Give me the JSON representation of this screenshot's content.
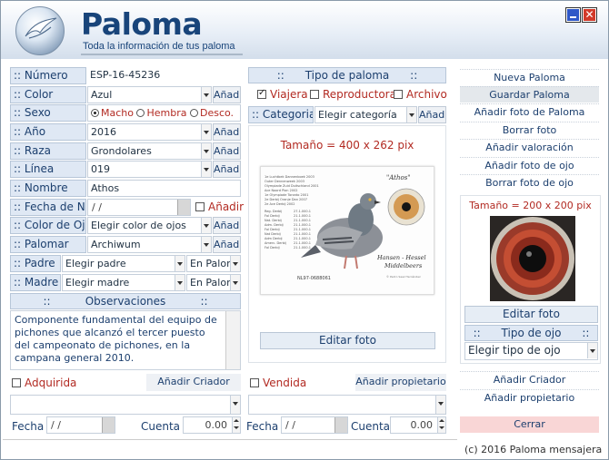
{
  "app": {
    "brand": "Paloma",
    "tagline": "Toda la información de tus paloma",
    "copyright": "(c) 2016 Paloma mensajera"
  },
  "form": {
    "numero": {
      "label": ":: Número",
      "value": "ESP-16-45236"
    },
    "color": {
      "label": ":: Color",
      "value": "Azul",
      "add": "Añad."
    },
    "sexo": {
      "label": ":: Sexo",
      "options": [
        "Macho",
        "Hembra",
        "Desco."
      ],
      "selected": "Macho"
    },
    "anio": {
      "label": ":: Año",
      "value": "2016",
      "add": "Añad."
    },
    "raza": {
      "label": ":: Raza",
      "value": "Grondolares",
      "add": "Añad."
    },
    "linea": {
      "label": ":: Línea",
      "value": "019",
      "add": "Añad."
    },
    "nombre": {
      "label": ":: Nombre",
      "value": "Athos"
    },
    "fecha_na": {
      "label": ":: Fecha de Na.",
      "value": "/ /",
      "check_label": "Añadir"
    },
    "color_ojo": {
      "label": ":: Color de Ojo",
      "placeholder": "Elegir color de ojos",
      "add": "Añad."
    },
    "palomar": {
      "label": ":: Palomar",
      "value": "Archiwum",
      "add": "Añad."
    },
    "padre": {
      "label": ":: Padre",
      "placeholder": "Elegir padre",
      "palomar": "En Palom"
    },
    "madre": {
      "label": ":: Madre",
      "placeholder": "Elegir madre",
      "palomar": "En Palom"
    },
    "observaciones": {
      "title": "::          Observaciones          ::",
      "text": "Componente fundamental del equipo de pichones que alcanzó el tercer puesto del campeonato de pichones, en la campana general 2010."
    },
    "adquirida": {
      "label": "Adquirida",
      "button": "Añadir Criador",
      "fecha_label": "Fecha",
      "fecha": "/ /",
      "cuenta_label": "Cuenta :",
      "cuenta": "0.00"
    },
    "vendida": {
      "label": "Vendida",
      "button": "Añadir propietario",
      "fecha_label": "Fecha :",
      "fecha": "/ /",
      "cuenta_label": "Cuenta :",
      "cuenta": "0.00"
    }
  },
  "tipo": {
    "title": "::      Tipo de paloma      ::",
    "options": [
      {
        "label": "Viajera",
        "checked": true
      },
      {
        "label": "Reproductora",
        "checked": false
      },
      {
        "label": "Archivo",
        "checked": false
      }
    ],
    "categorias_label": ":: Categorias",
    "categorias_placeholder": "Elegir categoría",
    "add": "Añad."
  },
  "photo": {
    "size_label": "Tamaño = 400 x 262 pix",
    "edit": "Editar foto",
    "card": {
      "name": "\"Athos\"",
      "ring": "NL97-0688061",
      "owner": "Hansen - Hessel",
      "place": "Middelbeers",
      "credit": "© Pedro Saez Hernández",
      "lines": [
        "1e Luchtbek Dannenboek 2003",
        "Outer Dennenweek 2003",
        "Olympiade Zuid Duitschland 2001",
        "Ace Noord Pion 2002",
        "1e Olympiade Toronto 2001",
        "2e Derbij Oranje Dan 2007",
        "2e Ace Derbij 2002"
      ],
      "results": [
        [
          "Reg. Derbij",
          "27.1.000.1"
        ],
        [
          "Fol Derbij",
          "21.1.000.1"
        ],
        [
          "Nat. Derbij",
          "21.1.000.1"
        ],
        [
          "Adm. Derbij",
          "21.1.000.1"
        ],
        [
          "Fol Derbij",
          "21.1.000.1"
        ],
        [
          "Nat Derbij",
          "21.1.000.1"
        ],
        [
          "Adm Derbij",
          "21.1.000.1"
        ],
        [
          "Amerc. Derbij",
          "21.1.000.1"
        ],
        [
          "Fol Derbij",
          "21.1.000.1"
        ]
      ]
    }
  },
  "eye": {
    "size_label": "Tamaño = 200 x 200 pix",
    "edit": "Editar foto",
    "tipo_title": "::      Tipo de ojo      ::",
    "tipo_placeholder": "Elegir tipo de ojo"
  },
  "actions": {
    "nueva": "Nueva Paloma",
    "guardar": "Guardar Paloma",
    "anadir_foto": "Añadir foto de Paloma",
    "borrar_foto": "Borrar foto",
    "anadir_valoracion": "Añadir valoración",
    "anadir_foto_ojo": "Añadir foto de ojo",
    "borrar_foto_ojo": "Borrar foto de ojo",
    "anadir_criador": "Añadir Criador",
    "anadir_propietario": "Añadir propietario",
    "cerrar": "Cerrar"
  },
  "colors": {
    "brand": "#18447a",
    "label_bg": "#dfe8f4",
    "accent_red": "#b22a22",
    "close_bg": "#f9d6d6"
  }
}
